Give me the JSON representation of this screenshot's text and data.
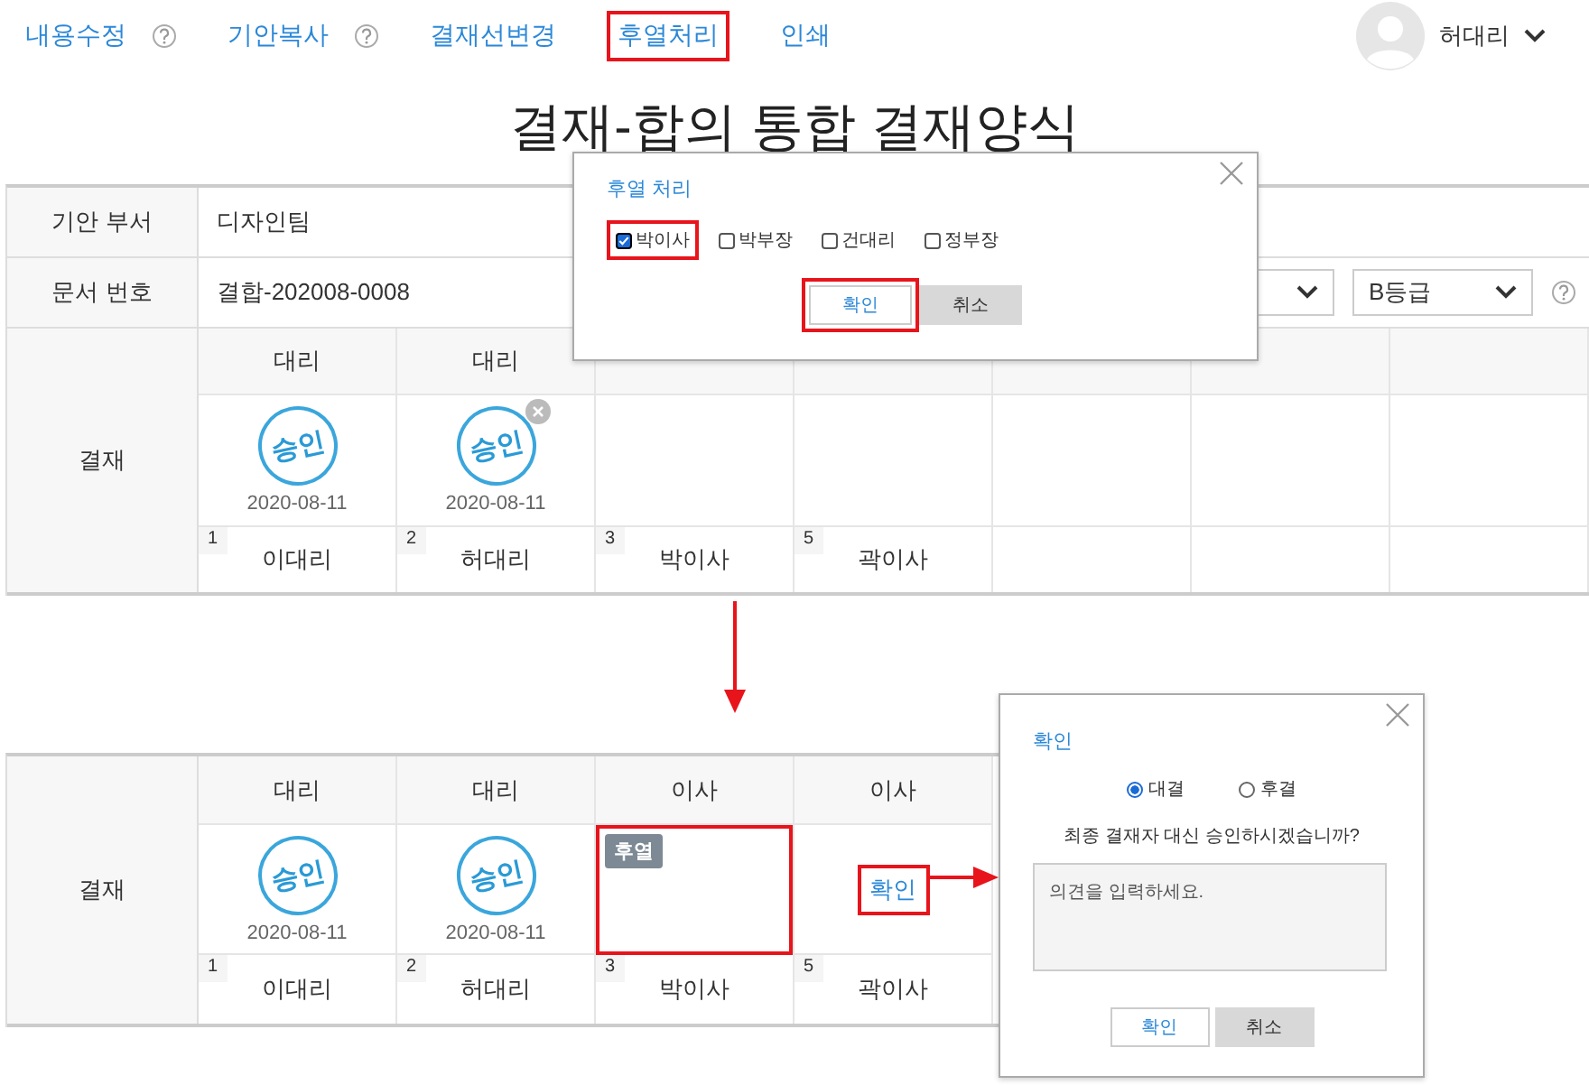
{
  "nav": {
    "items": [
      {
        "label": "내용수정",
        "help": true,
        "highlighted": false
      },
      {
        "label": "기안복사",
        "help": true,
        "highlighted": false
      },
      {
        "label": "결재선변경",
        "help": false,
        "highlighted": false
      },
      {
        "label": "후열처리",
        "help": false,
        "highlighted": true
      },
      {
        "label": "인쇄",
        "help": false,
        "highlighted": false
      }
    ],
    "user": {
      "name": "허대리"
    }
  },
  "title": "결재-합의 통합 결재양식",
  "form": {
    "rows": [
      {
        "label": "기안 부서",
        "value": "디자인팀"
      },
      {
        "label": "문서 번호",
        "value": "결합-202008-0008"
      }
    ],
    "grade": {
      "value": "B등급"
    }
  },
  "approval": {
    "label": "결재",
    "columns": [
      {
        "kind": "stamped",
        "rank": "대리",
        "stamp": "승인",
        "date": "2020-08-11",
        "removable": false,
        "order": "1",
        "name": "이대리"
      },
      {
        "kind": "stamped",
        "rank": "대리",
        "stamp": "승인",
        "date": "2020-08-11",
        "removable": true,
        "order": "2",
        "name": "허대리"
      },
      {
        "kind": "empty",
        "order": "3",
        "name": "박이사"
      },
      {
        "kind": "empty",
        "order": "5",
        "name": "곽이사"
      }
    ]
  },
  "dialog_post": {
    "title": "후열 처리",
    "options": [
      {
        "label": "박이사",
        "checked": true,
        "highlighted": true
      },
      {
        "label": "박부장",
        "checked": false,
        "highlighted": false
      },
      {
        "label": "건대리",
        "checked": false,
        "highlighted": false
      },
      {
        "label": "정부장",
        "checked": false,
        "highlighted": false
      }
    ],
    "buttons": [
      {
        "label": "확인",
        "kind": "primary",
        "highlighted": true
      },
      {
        "label": "취소",
        "kind": "secondary",
        "highlighted": false
      }
    ]
  },
  "result": {
    "label": "결재",
    "columns": [
      {
        "kind": "stamped",
        "rank": "대리",
        "stamp": "승인",
        "date": "2020-08-11",
        "removable": false,
        "order": "1",
        "name": "이대리"
      },
      {
        "kind": "stamped",
        "rank": "대리",
        "stamp": "승인",
        "date": "2020-08-11",
        "removable": false,
        "order": "2",
        "name": "허대리"
      },
      {
        "kind": "badge",
        "rank": "이사",
        "badge": "후열",
        "highlighted": true,
        "order": "3",
        "name": "박이사"
      },
      {
        "kind": "link",
        "rank": "이사",
        "link": "확인",
        "highlighted": true,
        "order": "5",
        "name": "곽이사"
      }
    ]
  },
  "dialog_confirm": {
    "title": "확인",
    "radios": [
      {
        "label": "대결",
        "selected": true
      },
      {
        "label": "후결",
        "selected": false
      }
    ],
    "question": "최종 결재자 대신 승인하시겠습니까?",
    "comment": {
      "placeholder": "의견을 입력하세요."
    },
    "buttons": [
      {
        "label": "확인",
        "kind": "primary",
        "highlighted": false
      },
      {
        "label": "취소",
        "kind": "secondary",
        "highlighted": false
      }
    ]
  }
}
